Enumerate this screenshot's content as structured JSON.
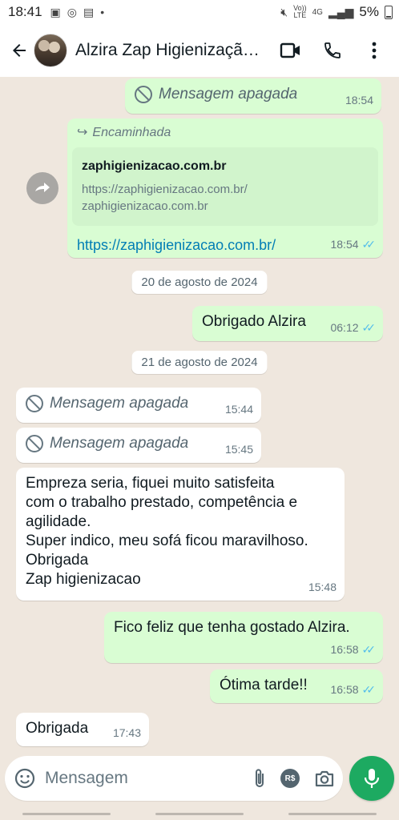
{
  "status": {
    "time": "18:41",
    "battery": "5%",
    "net_vo": "Vo))",
    "net_lte": "LTE",
    "net_4g": "4G"
  },
  "header": {
    "title": "Alzira Zap Higienizaçã…"
  },
  "messages": {
    "m1": {
      "text": "Mensagem apagada",
      "time": "18:54"
    },
    "m2": {
      "forward_label": "Encaminhada",
      "preview_title": "zaphigienizacao.com.br",
      "preview_desc": "https://zaphigienizacao.com.br/ zaphigienizacao.com.br",
      "link": "https://zaphigienizacao.com.br/",
      "time": "18:54"
    },
    "date1": "20 de agosto de 2024",
    "m3": {
      "text": "Obrigado Alzira",
      "time": "06:12"
    },
    "date2": "21 de agosto de 2024",
    "m4": {
      "text": "Mensagem apagada",
      "time": "15:44"
    },
    "m5": {
      "text": "Mensagem apagada",
      "time": "15:45"
    },
    "m6": {
      "line1": "Empreza seria,  fiquei muito satisfeita",
      "line2": "com o trabalho prestado, competência e",
      "line3": "agilidade.",
      "line4": "Super indico, meu sofá ficou maravilhoso.",
      "line5": "Obrigada",
      "line6": "Zap higienizacao",
      "time": "15:48"
    },
    "m7": {
      "text": "Fico feliz que tenha gostado Alzira.",
      "time": "16:58"
    },
    "m8": {
      "text": "Ótima tarde!!",
      "time": "16:58"
    },
    "m9": {
      "text": "Obrigada",
      "time": "17:43"
    }
  },
  "composer": {
    "placeholder": "Mensagem",
    "currency": "R$"
  },
  "colors": {
    "outgoing": "#d9fdd3",
    "incoming": "#ffffff",
    "accent": "#1daa61",
    "read_ticks": "#53bdeb"
  }
}
